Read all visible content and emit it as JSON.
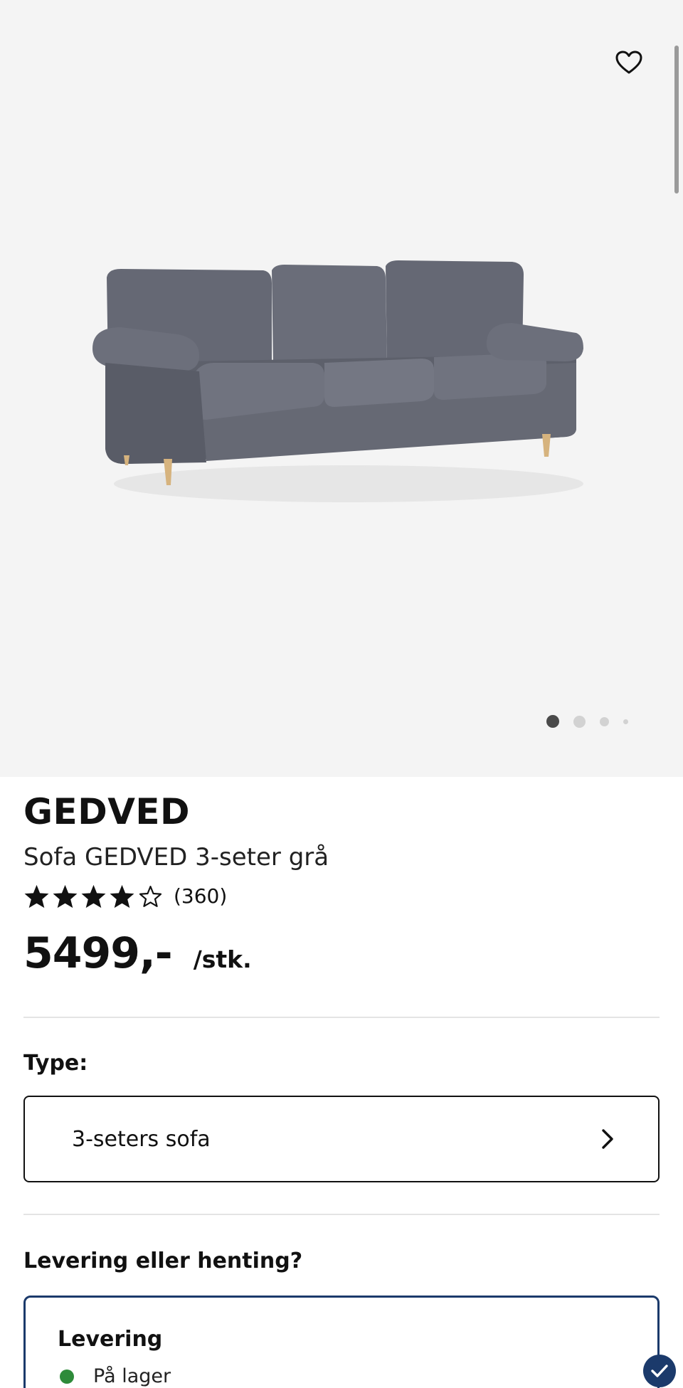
{
  "gallery": {
    "favorite_icon": "heart-outline-icon",
    "image_alt": "Sofa GEDVED 3-seter grå",
    "dots": [
      {
        "active": true
      },
      {
        "active": false
      },
      {
        "active": false
      },
      {
        "active": false
      }
    ]
  },
  "product": {
    "brand": "GEDVED",
    "subtitle": "Sofa GEDVED 3-seter grå",
    "rating": 4,
    "rating_max": 5,
    "rating_count": "(360)",
    "price": "5499,-",
    "unit": "/stk."
  },
  "type": {
    "label": "Type:",
    "value": "3-seters sofa",
    "chevron_icon": "chevron-right-icon"
  },
  "delivery": {
    "question": "Levering eller henting?",
    "option_title": "Levering",
    "stock_status": "På lager",
    "stock_color": "#2e8b3a",
    "selected_icon": "check-circle-icon"
  },
  "colors": {
    "accent": "#1b3a6b",
    "gallery_bg": "#f4f4f4"
  }
}
